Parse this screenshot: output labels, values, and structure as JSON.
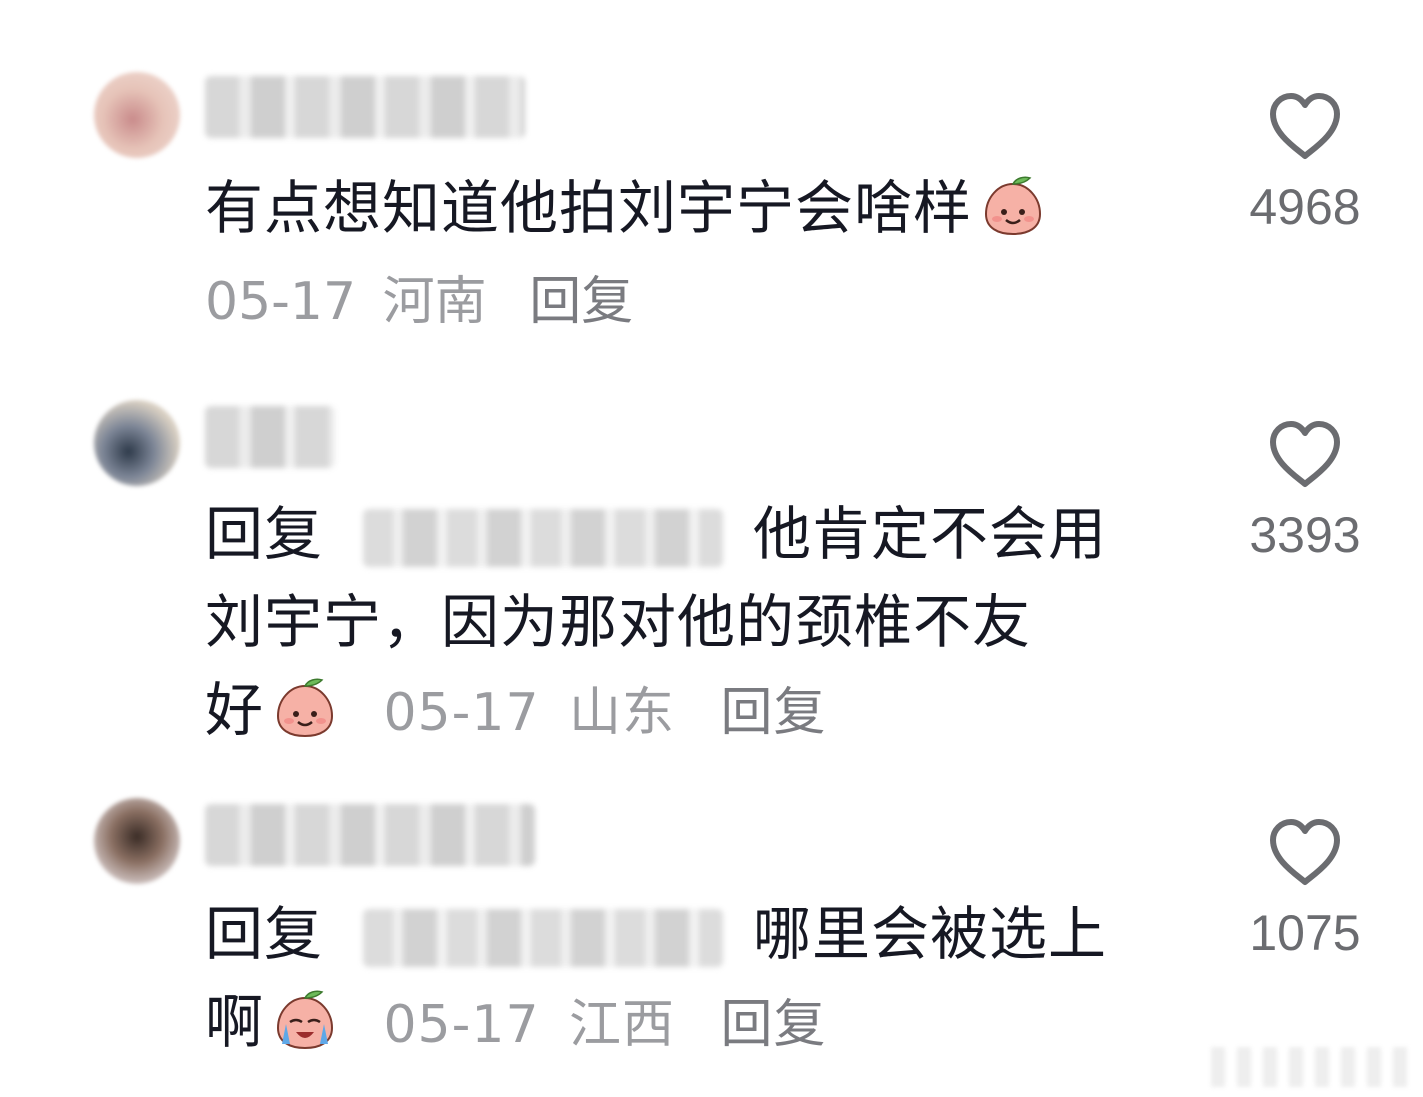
{
  "comments": [
    {
      "content": "有点想知道他拍刘宇宁会啥样",
      "emoji": "peach-smile",
      "date": "05-17",
      "location": "河南",
      "reply_label": "回复",
      "likes": "4968"
    },
    {
      "reply_prefix": "回复",
      "content_line1": "他肯定不会用",
      "content_line2": "刘宇宁，因为那对他的颈椎不友",
      "content_line3": "好",
      "emoji": "peach-smile",
      "date": "05-17",
      "location": "山东",
      "reply_label": "回复",
      "likes": "3393"
    },
    {
      "reply_prefix": "回复",
      "content_line1": "哪里会被选上",
      "content_line2": "啊",
      "emoji": "peach-crying-laughing",
      "date": "05-17",
      "location": "江西",
      "reply_label": "回复",
      "likes": "1075"
    }
  ],
  "icons": {
    "like": "heart-outline-icon",
    "emoji_color": "#f4a6a0"
  }
}
